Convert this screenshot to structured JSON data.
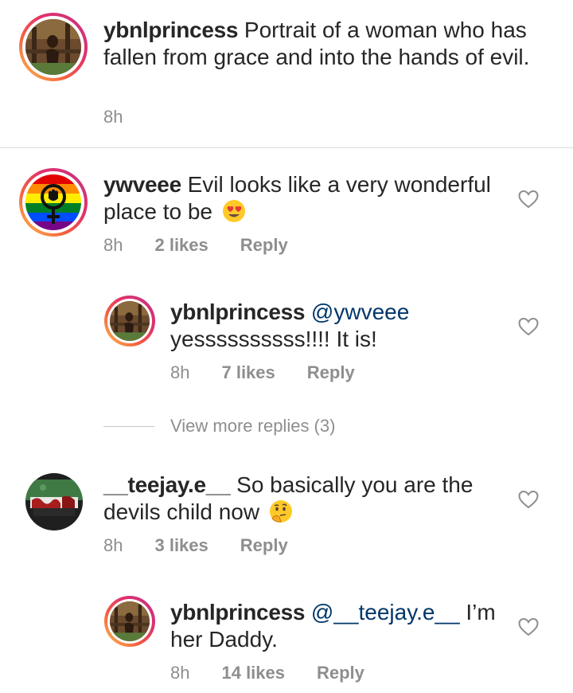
{
  "caption": {
    "username": "ybnlprincess",
    "text": "Portrait of a woman who has fallen from grace and into the hands of evil.",
    "time": "8h"
  },
  "comments": [
    {
      "username": "ywveee",
      "text": "Evil looks like a very wonderful place to be",
      "emoji": "heart-eyes-emoji",
      "time": "8h",
      "likes": "2 likes",
      "reply_label": "Reply",
      "reply": {
        "username": "ybnlprincess",
        "mention": "@ywveee",
        "text": "yessssssssss!!!! It is!",
        "time": "8h",
        "likes": "7 likes",
        "reply_label": "Reply"
      },
      "view_more": "View more replies (3)"
    },
    {
      "username": "__teejay.e__",
      "text": "So basically you are the devils child now",
      "emoji": "thinking-face-emoji",
      "time": "8h",
      "likes": "3 likes",
      "reply_label": "Reply",
      "reply": {
        "username": "ybnlprincess",
        "mention": "@__teejay.e__",
        "text": "I’m her Daddy.",
        "time": "8h",
        "likes": "14 likes",
        "reply_label": "Reply"
      }
    }
  ],
  "icons": {
    "like": "heart-outline-icon"
  },
  "colors": {
    "text": "#262626",
    "meta": "#8e8e8e",
    "mention": "#00376b"
  }
}
